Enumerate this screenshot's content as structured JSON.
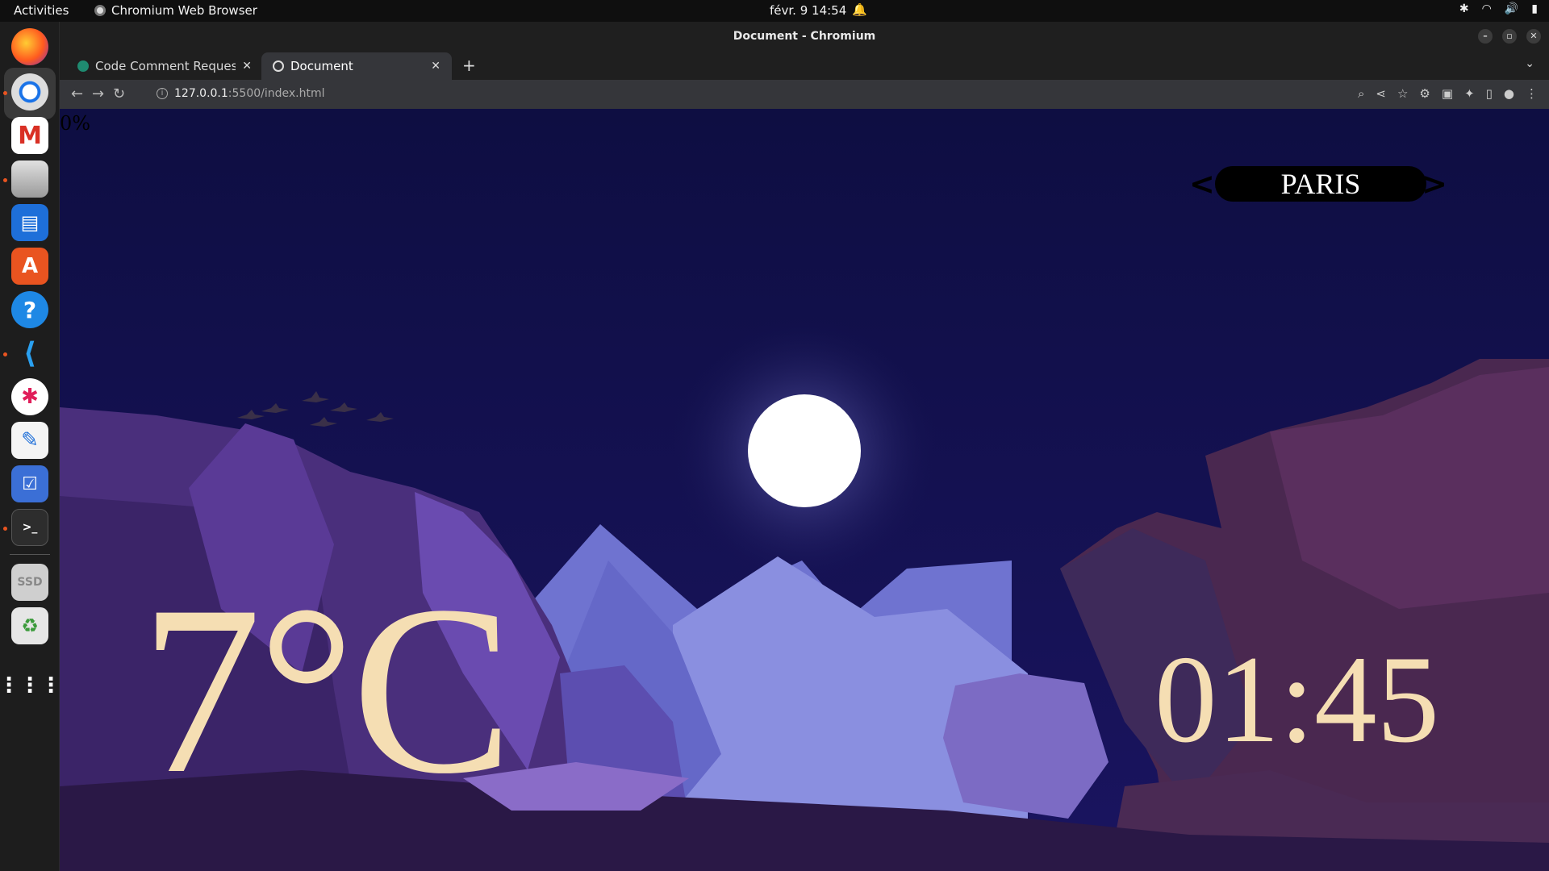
{
  "topbar": {
    "activities": "Activities",
    "app_name": "Chromium Web Browser",
    "clock": "févr. 9  14:54"
  },
  "dock": {
    "apps": [
      "firefox-icon",
      "chromium-icon",
      "mail-icon",
      "files-icon",
      "writer-icon",
      "app-center-icon",
      "help-icon",
      "vscode-icon",
      "slack-icon",
      "text-editor-icon",
      "todo-icon",
      "terminal-icon",
      "ssd-drive-icon",
      "trash-icon",
      "show-apps-icon"
    ],
    "ssd_label": "SSD"
  },
  "browser": {
    "window_title": "Document - Chromium",
    "tabs": [
      {
        "label": "Code Comment Requeste",
        "active": false
      },
      {
        "label": "Document",
        "active": true
      }
    ],
    "url_host": "127.0.0.1",
    "url_rest": ":5500/index.html"
  },
  "page": {
    "progress_text": "0%",
    "city": "PARIS",
    "prev_label": "<",
    "next_label": ">",
    "temperature": "7°C",
    "time": "01:45"
  },
  "colors": {
    "sky": "#10104a",
    "text_accent": "#f5deb3",
    "moon": "#ffffff"
  }
}
